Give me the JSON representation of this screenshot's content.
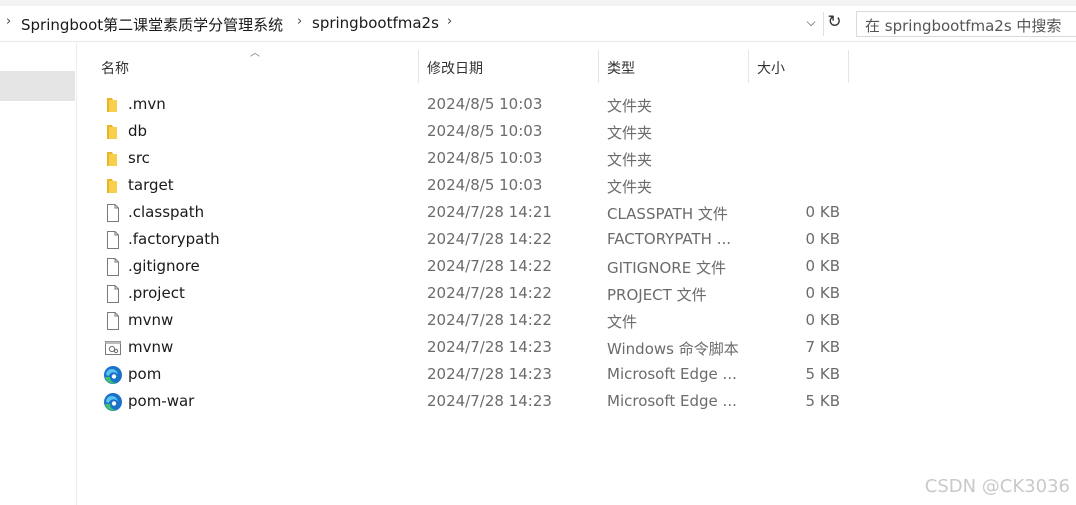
{
  "breadcrumb": {
    "items": [
      "Springboot第二课堂素质学分管理系统",
      "springbootfma2s"
    ]
  },
  "search": {
    "placeholder": "在 springbootfma2s 中搜索"
  },
  "columns": {
    "name": "名称",
    "date": "修改日期",
    "type": "类型",
    "size": "大小"
  },
  "files": [
    {
      "name": ".mvn",
      "date": "2024/8/5 10:03",
      "type": "文件夹",
      "size": "",
      "icon": "folder-icon"
    },
    {
      "name": "db",
      "date": "2024/8/5 10:03",
      "type": "文件夹",
      "size": "",
      "icon": "folder-icon"
    },
    {
      "name": "src",
      "date": "2024/8/5 10:03",
      "type": "文件夹",
      "size": "",
      "icon": "folder-icon"
    },
    {
      "name": "target",
      "date": "2024/8/5 10:03",
      "type": "文件夹",
      "size": "",
      "icon": "folder-icon"
    },
    {
      "name": ".classpath",
      "date": "2024/7/28 14:21",
      "type": "CLASSPATH 文件",
      "size": "0 KB",
      "icon": "file-icon"
    },
    {
      "name": ".factorypath",
      "date": "2024/7/28 14:22",
      "type": "FACTORYPATH ...",
      "size": "0 KB",
      "icon": "file-icon"
    },
    {
      "name": ".gitignore",
      "date": "2024/7/28 14:22",
      "type": "GITIGNORE 文件",
      "size": "0 KB",
      "icon": "file-icon"
    },
    {
      "name": ".project",
      "date": "2024/7/28 14:22",
      "type": "PROJECT 文件",
      "size": "0 KB",
      "icon": "file-icon"
    },
    {
      "name": "mvnw",
      "date": "2024/7/28 14:22",
      "type": "文件",
      "size": "0 KB",
      "icon": "file-icon"
    },
    {
      "name": "mvnw",
      "date": "2024/7/28 14:23",
      "type": "Windows 命令脚本",
      "size": "7 KB",
      "icon": "script-icon"
    },
    {
      "name": "pom",
      "date": "2024/7/28 14:23",
      "type": "Microsoft Edge ...",
      "size": "5 KB",
      "icon": "edge-icon"
    },
    {
      "name": "pom-war",
      "date": "2024/7/28 14:23",
      "type": "Microsoft Edge ...",
      "size": "5 KB",
      "icon": "edge-icon"
    }
  ],
  "watermark": "CSDN @CK3036",
  "colors": {
    "folder": "#f4c542",
    "edge_blue": "#1a73c9",
    "edge_green": "#3cc46a",
    "selection": "#e5e5e5"
  }
}
